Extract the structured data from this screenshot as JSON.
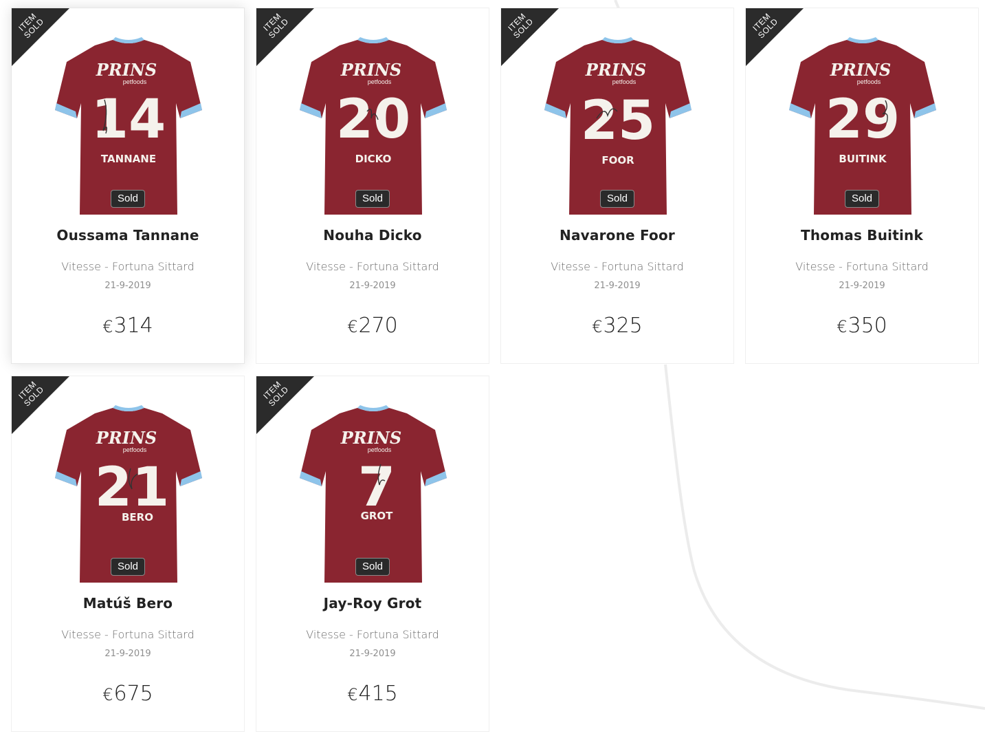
{
  "ribbon": {
    "line1": "ITEM",
    "line2": "SOLD"
  },
  "shirt_colors": {
    "body": "#8a2530",
    "sleeve_trim": "#8ec4ea",
    "number": "#f5f2ec"
  },
  "items": [
    {
      "name": "Oussama Tannane",
      "match": "Vitesse - Fortuna Sittard",
      "date": "21-9-2019",
      "currency": "€",
      "price": "314",
      "status": "Sold",
      "shirt_number": "14",
      "shirt_name": "TANNANE",
      "sponsor": "PRINS",
      "sponsor_sub": "petfoods"
    },
    {
      "name": "Nouha Dicko",
      "match": "Vitesse - Fortuna Sittard",
      "date": "21-9-2019",
      "currency": "€",
      "price": "270",
      "status": "Sold",
      "shirt_number": "20",
      "shirt_name": "DICKO",
      "sponsor": "PRINS",
      "sponsor_sub": "petfoods"
    },
    {
      "name": "Navarone Foor",
      "match": "Vitesse - Fortuna Sittard",
      "date": "21-9-2019",
      "currency": "€",
      "price": "325",
      "status": "Sold",
      "shirt_number": "25",
      "shirt_name": "FOOR",
      "sponsor": "PRINS",
      "sponsor_sub": "petfoods"
    },
    {
      "name": "Thomas Buitink",
      "match": "Vitesse - Fortuna Sittard",
      "date": "21-9-2019",
      "currency": "€",
      "price": "350",
      "status": "Sold",
      "shirt_number": "29",
      "shirt_name": "BUITINK",
      "sponsor": "PRINS",
      "sponsor_sub": "petfoods"
    },
    {
      "name": "Matúš Bero",
      "match": "Vitesse - Fortuna Sittard",
      "date": "21-9-2019",
      "currency": "€",
      "price": "675",
      "status": "Sold",
      "shirt_number": "21",
      "shirt_name": "BERO",
      "sponsor": "PRINS",
      "sponsor_sub": "petfoods"
    },
    {
      "name": "Jay-Roy Grot",
      "match": "Vitesse - Fortuna Sittard",
      "date": "21-9-2019",
      "currency": "€",
      "price": "415",
      "status": "Sold",
      "shirt_number": "7",
      "shirt_name": "GROT",
      "sponsor": "PRINS",
      "sponsor_sub": "petfoods"
    }
  ]
}
